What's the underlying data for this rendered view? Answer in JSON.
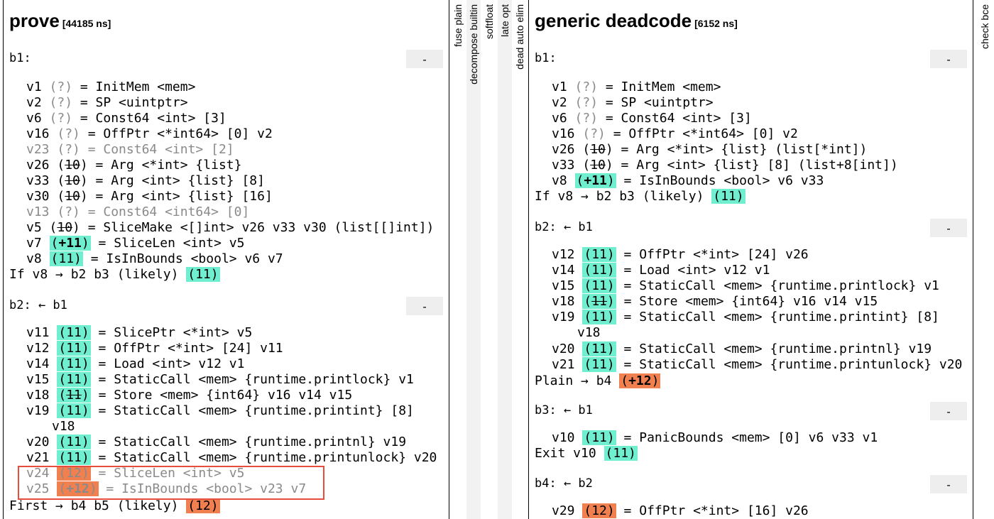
{
  "left": {
    "title": "prove",
    "time": "[44185 ns]",
    "collapse_label": "-",
    "blocks": [
      {
        "head": "b1:"
      },
      {
        "head": "b2: ← b1"
      }
    ],
    "lines": [
      "v1 (?) = InitMem <mem>",
      "v2 (?) = SP <uintptr>",
      "v6 (?) = Const64 <int> [3]",
      "v16 (?) = OffPtr <*int64> [0] v2",
      "v23 (?) = Const64 <int> [2]",
      "v26 (10) = Arg <*int> {list}",
      "v33 (10) = Arg <int> {list} [8]",
      "v30 (10) = Arg <int> {list} [16]",
      "v13 (?) = Const64 <int64> [0]",
      "v5 (10) = SliceMake <[]int> v26 v33 v30 (list[[]int])",
      "v7 (+11) = SliceLen <int> v5",
      "v8 (11) = IsInBounds <bool> v6 v7",
      "If v8 → b2 b3 (likely) (11)",
      "v11 (11) = SlicePtr <*int> v5",
      "v12 (11) = OffPtr <*int> [24] v11",
      "v14 (11) = Load <int> v12 v1",
      "v15 (11) = StaticCall <mem> {runtime.printlock} v1",
      "v18 (11) = Store <mem> {int64} v16 v14 v15",
      "v19 (11) = StaticCall <mem> {runtime.printint} [8]",
      "v18",
      "v20 (11) = StaticCall <mem> {runtime.printnl} v19",
      "v21 (11) = StaticCall <mem> {runtime.printunlock} v20",
      "v24 (12) = SliceLen <int> v5",
      "v25 (+12) = IsInBounds <bool> v23 v7",
      "First → b4 b5 (likely) (12)"
    ]
  },
  "collapsed": [
    "fuse plain",
    "decompose builtin",
    "softfloat",
    "late opt",
    "dead auto elim",
    "check bce"
  ],
  "right": {
    "title": "generic deadcode",
    "time": "[6152 ns]",
    "collapse_label": "-",
    "blocks": [
      {
        "head": "b1:"
      },
      {
        "head": "b2: ← b1"
      },
      {
        "head": "b3: ← b1"
      },
      {
        "head": "b4: ← b2"
      }
    ],
    "lines": [
      "v1 (?) = InitMem <mem>",
      "v2 (?) = SP <uintptr>",
      "v6 (?) = Const64 <int> [3]",
      "v16 (?) = OffPtr <*int64> [0] v2",
      "v26 (10) = Arg <*int> {list} (list[*int])",
      "v33 (10) = Arg <int> {list} [8] (list+8[int])",
      "v8 (+11) = IsInBounds <bool> v6 v33",
      "If v8 → b2 b3 (likely) (11)",
      "v12 (11) = OffPtr <*int> [24] v26",
      "v14 (11) = Load <int> v12 v1",
      "v15 (11) = StaticCall <mem> {runtime.printlock} v1",
      "v18 (11) = Store <mem> {int64} v16 v14 v15",
      "v19 (11) = StaticCall <mem> {runtime.printint} [8]",
      "v18",
      "v20 (11) = StaticCall <mem> {runtime.printnl} v19",
      "v21 (11) = StaticCall <mem> {runtime.printunlock} v20",
      "Plain → b4 (+12)",
      "v10 (11) = PanicBounds <mem> [0] v6 v33 v1",
      "Exit v10 (11)",
      "v29 (12) = OffPtr <*int> [16] v26"
    ]
  },
  "colors": {
    "green_tag": "#6fefcf",
    "orange_tag": "#f08050",
    "highlight_border": "#e74c3c",
    "dead_text": "#8a8a8a"
  }
}
